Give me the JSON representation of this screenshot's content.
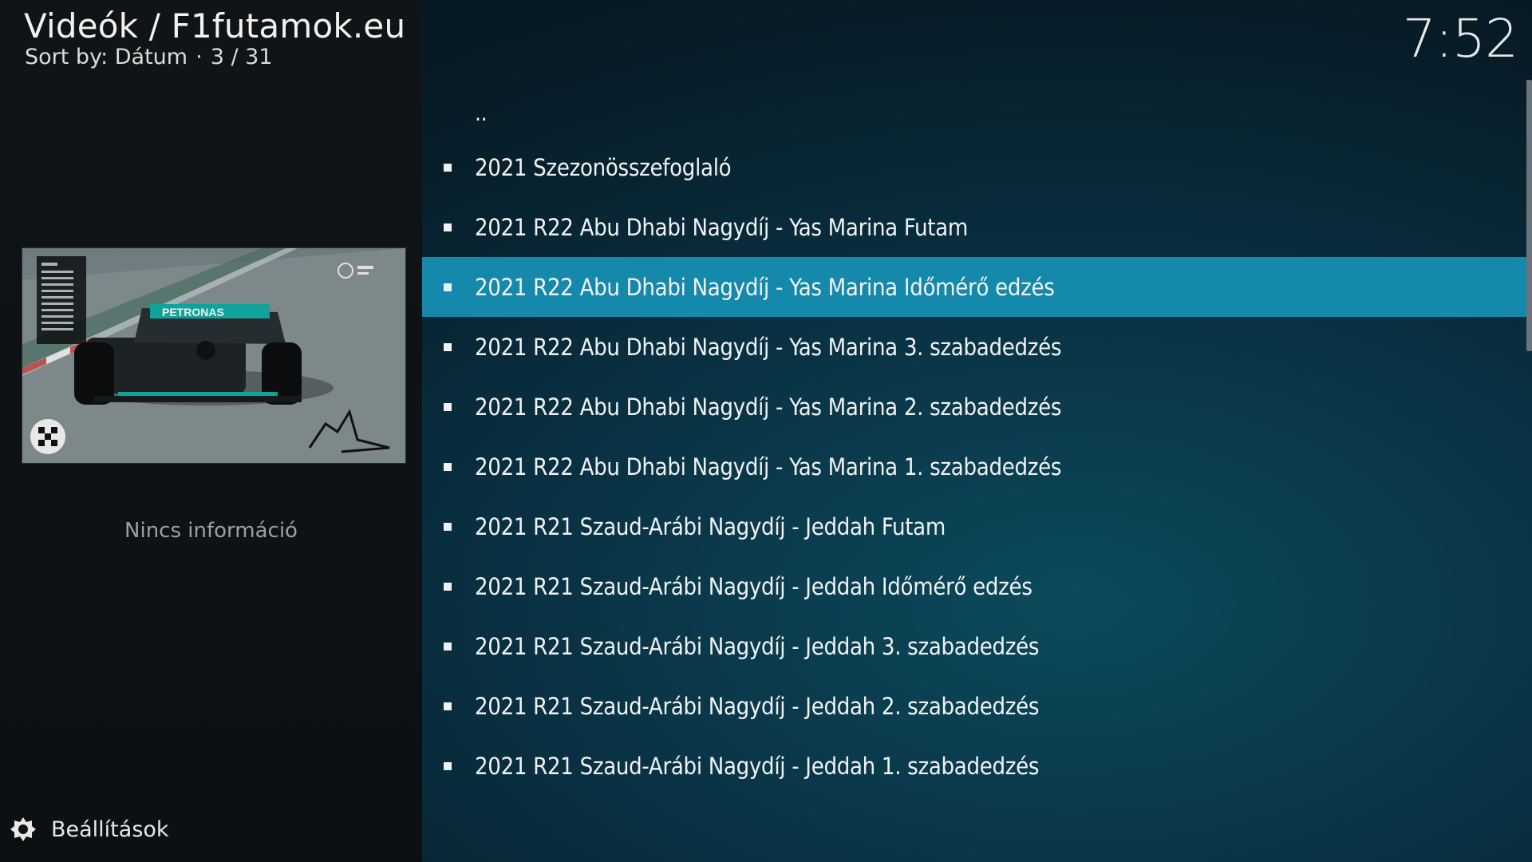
{
  "header": {
    "path": "Videók / F1futamok.eu",
    "sort_label": "Sort by: Dátum",
    "separator": "·",
    "position": "3 / 31"
  },
  "clock": "7:52",
  "info": {
    "no_info": "Nincs információ"
  },
  "settings": {
    "label": "Beállítások",
    "icon": "settings-icon"
  },
  "list": {
    "parent": "..",
    "items": [
      {
        "label": "2021 Szezonösszefoglaló",
        "selected": false
      },
      {
        "label": "2021 R22  Abu Dhabi Nagydíj - Yas Marina Futam",
        "selected": false
      },
      {
        "label": "2021 R22  Abu Dhabi Nagydíj - Yas Marina Időmérő edzés",
        "selected": true
      },
      {
        "label": "2021 R22  Abu Dhabi Nagydíj - Yas Marina 3. szabadedzés",
        "selected": false
      },
      {
        "label": "2021 R22  Abu Dhabi Nagydíj - Yas Marina 2. szabadedzés",
        "selected": false
      },
      {
        "label": "2021 R22  Abu Dhabi Nagydíj - Yas Marina 1. szabadedzés",
        "selected": false
      },
      {
        "label": "2021 R21 Szaud-Arábi Nagydíj - Jeddah Futam",
        "selected": false
      },
      {
        "label": "2021 R21 Szaud-Arábi Nagydíj - Jeddah Időmérő edzés",
        "selected": false
      },
      {
        "label": "2021 R21 Szaud-Arábi Nagydíj - Jeddah 3. szabadedzés",
        "selected": false
      },
      {
        "label": "2021 R21 Szaud-Arábi Nagydíj - Jeddah 2. szabadedzés",
        "selected": false
      },
      {
        "label": "2021 R21 Szaud-Arábi Nagydíj - Jeddah 1. szabadedzés",
        "selected": false
      }
    ]
  },
  "thumbnail": {
    "car_livery": "PETRONAS"
  },
  "colors": {
    "selection": "#1589ab",
    "left_panel": "#101416"
  }
}
